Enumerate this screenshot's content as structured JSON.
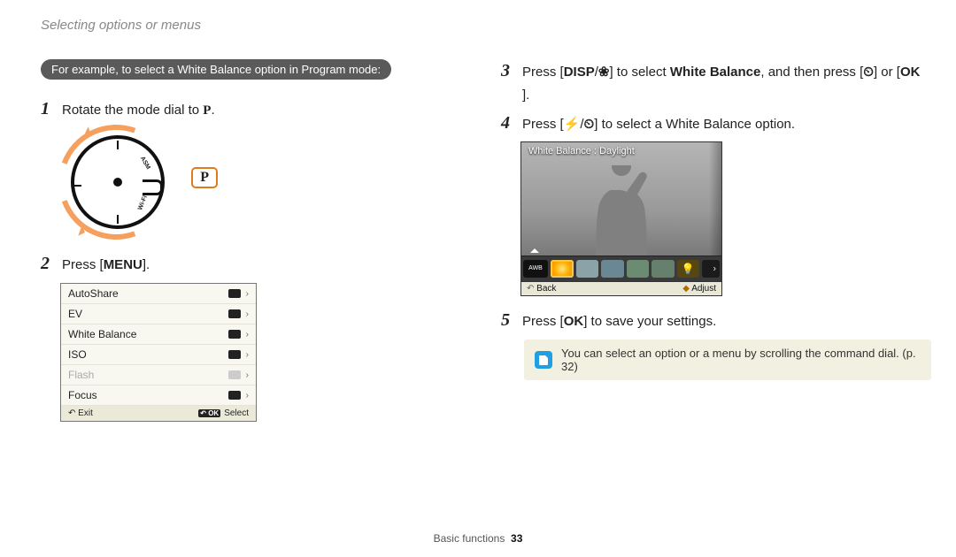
{
  "header": {
    "title": "Selecting options or menus"
  },
  "example_label": "For example, to select a White Balance option in Program mode:",
  "steps": {
    "s1_num": "1",
    "s1_pre": "Rotate the mode dial to ",
    "s1_icon": "P",
    "s1_post": ".",
    "s2_num": "2",
    "s2_pre": "Press [",
    "s2_btn": "MENU",
    "s2_post": "].",
    "s3_num": "3",
    "s3_a": "Press [",
    "s3_b": "DISP",
    "s3_c": "/",
    "s3_d": "❀",
    "s3_e": "] to select ",
    "s3_f": "White Balance",
    "s3_g": ", and then press [",
    "s3_h": "⏲",
    "s3_i": "] or [",
    "s3_j": "OK",
    "s3_k": "].",
    "s4_num": "4",
    "s4_a": "Press [",
    "s4_b": "⚡",
    "s4_c": "/",
    "s4_d": "⏲",
    "s4_e": "] to select a White Balance option.",
    "s5_num": "5",
    "s5_a": "Press [",
    "s5_b": "OK",
    "s5_c": "] to save your settings."
  },
  "mode_dial": {
    "callout": "P",
    "marks": [
      "ASM",
      "Wi-Fi"
    ]
  },
  "menu_screenshot": {
    "items": [
      {
        "label": "AutoShare",
        "enabled": true
      },
      {
        "label": "EV",
        "enabled": true
      },
      {
        "label": "White Balance",
        "enabled": true
      },
      {
        "label": "ISO",
        "enabled": true
      },
      {
        "label": "Flash",
        "enabled": false
      },
      {
        "label": "Focus",
        "enabled": true
      }
    ],
    "footer_left": "Exit",
    "footer_ok": "OK",
    "footer_right": "Select"
  },
  "wb_screenshot": {
    "title": "White Balance : Daylight",
    "footer_left": "Back",
    "footer_right": "Adjust",
    "icons": [
      {
        "label": "AWB",
        "cls": "auto"
      },
      {
        "label": "",
        "cls": "sun"
      },
      {
        "label": "",
        "cls": "cloud"
      },
      {
        "label": "",
        "cls": "f1"
      },
      {
        "label": "",
        "cls": "f2"
      },
      {
        "label": "",
        "cls": "f3"
      },
      {
        "label": "",
        "cls": "bulb"
      },
      {
        "label": "",
        "cls": "more"
      }
    ]
  },
  "note": {
    "text": "You can select an option or a menu by scrolling the command dial. (p. 32)"
  },
  "footer": {
    "section": "Basic functions",
    "page": "33"
  }
}
